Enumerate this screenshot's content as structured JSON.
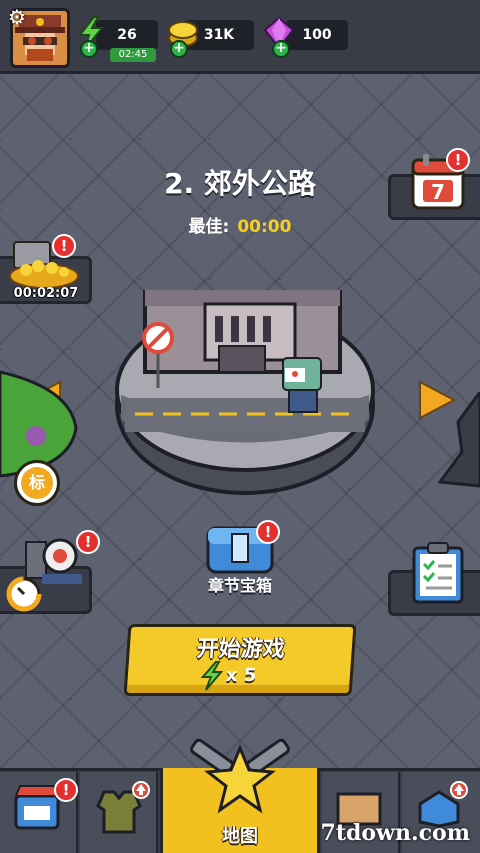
{
  "header": {
    "energy": {
      "value": "26",
      "timer": "02:45",
      "icon": "lightning-icon"
    },
    "coins": {
      "value": "31K",
      "icon": "coin-icon"
    },
    "gems": {
      "value": "100",
      "icon": "gem-icon"
    }
  },
  "stage": {
    "title": "2. 郊外公路",
    "best_label": "最佳:",
    "best_value": "00:00"
  },
  "left_panel": {
    "gold_timer": "00:02:07",
    "tag_label": "标"
  },
  "chest": {
    "label": "章节宝箱"
  },
  "start_button": {
    "label": "开始游戏",
    "cost": "x 5"
  },
  "nav": {
    "active_label": "地图"
  },
  "badge_mark": "!",
  "watermark": "7tdown.com",
  "colors": {
    "accent": "#f4c92a",
    "badge": "#e53030",
    "panel": "#3a3d48",
    "plus": "#2fb34a"
  }
}
